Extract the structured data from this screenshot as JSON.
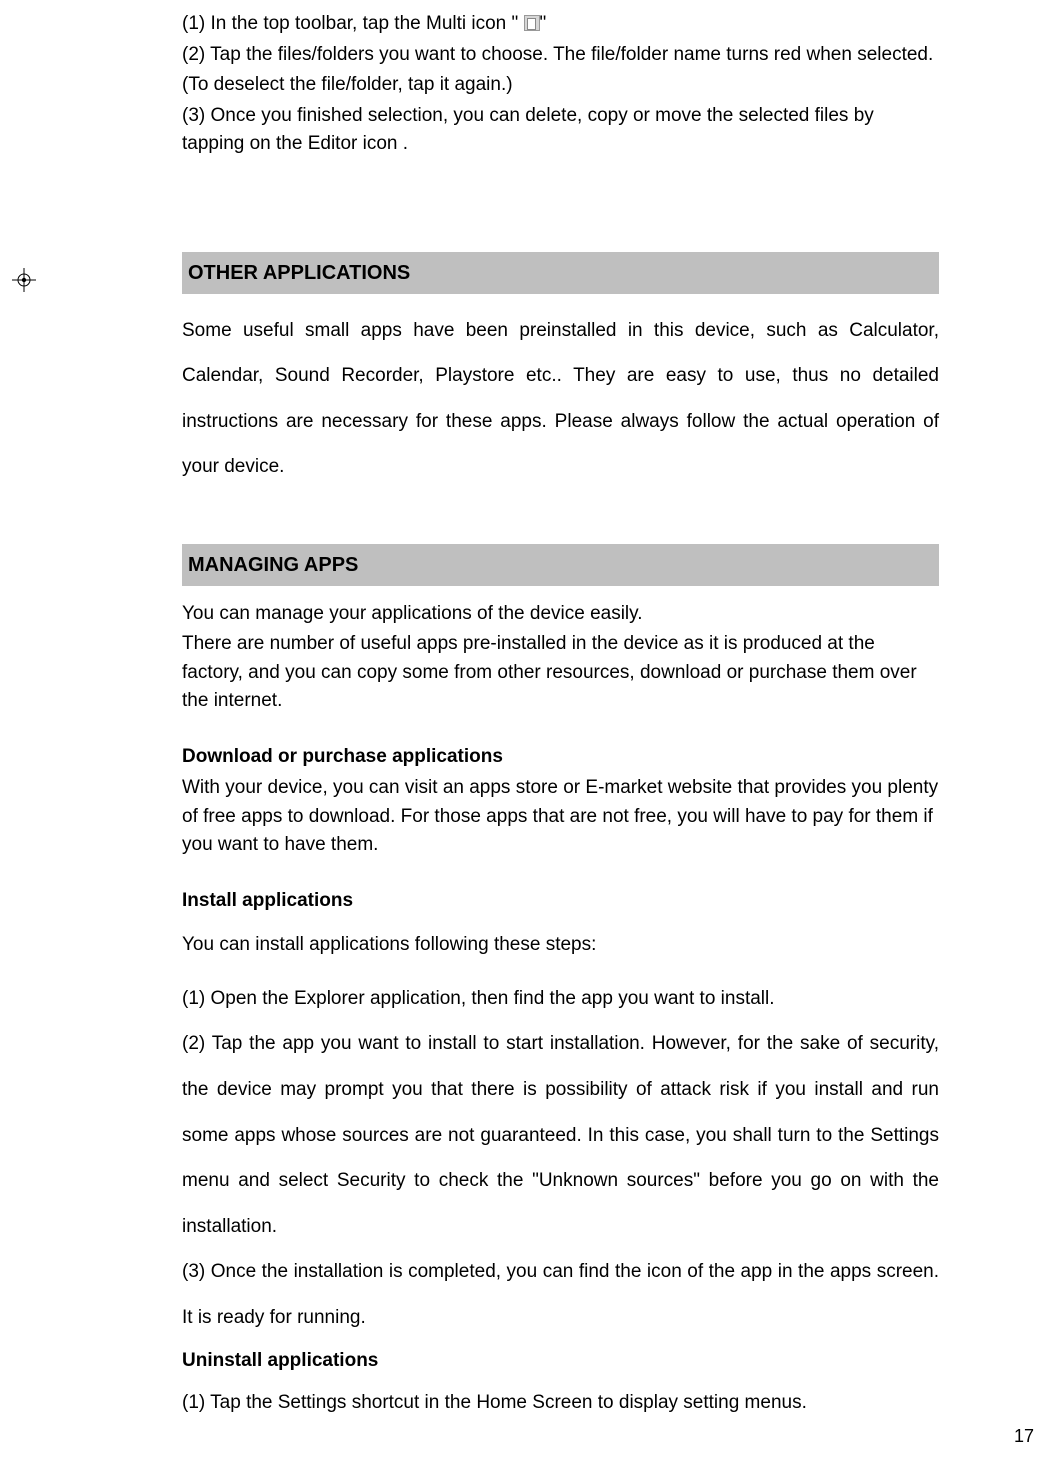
{
  "top": {
    "line1_pre": "(1)    In the top toolbar, tap the Multi icon \" ",
    "line1_post": "\"",
    "line2": "(2)    Tap the files/folders you want to choose. The file/folder name turns red when selected.",
    "line3": "(To deselect the file/folder, tap it again.)",
    "line4": "(3)    Once you finished selection, you can delete, copy or move the selected files by tapping on the Editor icon  ."
  },
  "other_apps": {
    "heading": "OTHER APPLICATIONS",
    "body": "Some useful small apps have been preinstalled in this device, such as Calculator, Calendar, Sound Recorder, Playstore etc.. They are easy to use, thus no detailed instructions are necessary for these apps. Please always follow the actual operation of your device."
  },
  "managing": {
    "heading": "MANAGING APPS",
    "intro1": "You can manage your applications of the device easily.",
    "intro2": "There are number of useful apps pre-installed in the device as it is produced at the factory, and you can copy some from other resources, download or purchase them over the internet.",
    "sub1_heading": "Download or purchase applications",
    "sub1_body": "With your device, you can visit an apps store or E-market website that provides you plenty of free apps to download. For those apps that are not free, you will have to pay for them if you want to have them.",
    "sub2_heading": "Install applications",
    "sub2_intro": "You can install applications following these steps:",
    "sub2_item1": "(1)    Open the Explorer application, then find the app you want to install.",
    "sub2_item2": "(2)    Tap the app you want to install to start installation. However, for the sake of security, the device may prompt you that there is possibility of attack risk if you install and run some apps whose sources are not guaranteed. In this case, you shall turn to the Settings menu and select Security to check the \"Unknown sources\" before you go on with the installation.",
    "sub2_item3": "(3)    Once the installation is completed, you can find the icon of the app in the apps screen. It is ready for running.",
    "sub3_heading": "Uninstall applications",
    "sub3_item1": "(1)    Tap the Settings shortcut in the Home Screen to display setting menus."
  },
  "page_number": "17"
}
